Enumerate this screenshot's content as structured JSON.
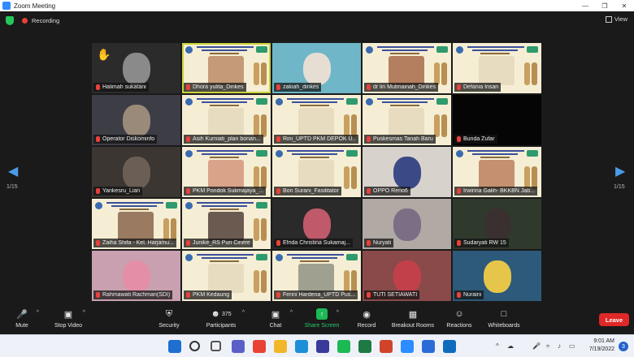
{
  "window": {
    "title": "Zoom Meeting"
  },
  "meeting": {
    "recording_label": "Recording",
    "view_label": "View"
  },
  "gallery": {
    "page_left": "1/15",
    "page_right": "1/15",
    "tiles": [
      {
        "name": "Halimah sukatani",
        "kind": "video",
        "bg": "#2b2b2b",
        "face": "#8a8a8a",
        "hand": true
      },
      {
        "name": "Dhora yulita_Dinkes",
        "kind": "poster",
        "inset": "#c49a78",
        "active": true
      },
      {
        "name": "zakiah_dinkes",
        "kind": "video",
        "bg": "#6fb6c8",
        "face": "#e7ded3"
      },
      {
        "name": "dr lin Mutmainah_Dinkes",
        "kind": "poster",
        "inset": "#b47f5e"
      },
      {
        "name": "Defania Insan",
        "kind": "poster",
        "inset": "#e8dcc0"
      },
      {
        "name": "Operator Diskominfo",
        "kind": "video",
        "bg": "#3d3d46",
        "face": "#9a8a7a"
      },
      {
        "name": "Asih Kurniati_plan bonan...",
        "kind": "poster",
        "inset": "#e8dcc0"
      },
      {
        "name": "Rini_UPTD PKM DEPOK U...",
        "kind": "poster",
        "inset": "#e8dcc0"
      },
      {
        "name": "Puskesmas Tanah Baru",
        "kind": "poster",
        "inset": "#e8dcc0"
      },
      {
        "name": "Bunda Zufar",
        "kind": "video",
        "bg": "#050505",
        "face": "#050505"
      },
      {
        "name": "Yankesru_Lian",
        "kind": "video",
        "bg": "#3b3632",
        "face": "#6b5f55"
      },
      {
        "name": "PKM Pondok Sukmajaya_...",
        "kind": "poster",
        "inset": "#d9a38a"
      },
      {
        "name": "Bon Surani_Fasilitator",
        "kind": "poster",
        "inset": "#e8dcc0"
      },
      {
        "name": "OPPO Reno6",
        "kind": "video",
        "bg": "#d8d2cc",
        "face": "#3b4a86"
      },
      {
        "name": "Irwinna Galih- BKKBN Jab...",
        "kind": "poster",
        "inset": "#c49070"
      },
      {
        "name": "Zaiha Shifa - Kel. Harjamu...",
        "kind": "poster",
        "inset": "#9a7a60"
      },
      {
        "name": "Junike_RS Puri Cinere",
        "kind": "poster",
        "inset": "#6a5a50"
      },
      {
        "name": "Efrida Christina Sukamaj...",
        "kind": "video",
        "bg": "#2a2a2a",
        "face": "#c05a6a"
      },
      {
        "name": "Nuryati",
        "kind": "video",
        "bg": "#b0a9a4",
        "face": "#7a6f84"
      },
      {
        "name": "Sudaryati RW 15",
        "kind": "video",
        "bg": "#2f3a2c",
        "face": "#3a3030"
      },
      {
        "name": "Rahmawati Rachman(SDI)",
        "kind": "video",
        "bg": "#c9a0b0",
        "face": "#e38fa8"
      },
      {
        "name": "PKM Kedaung",
        "kind": "poster",
        "inset": "#e8dcc0"
      },
      {
        "name": "Fenni Hardena_UPTD Pus...",
        "kind": "poster",
        "inset": "#a0a090"
      },
      {
        "name": "TUTI SETIAWATI",
        "kind": "video",
        "bg": "#8a4a4a",
        "face": "#c2404a"
      },
      {
        "name": "Nuraini",
        "kind": "video",
        "bg": "#2d5a7a",
        "face": "#e6c64a"
      }
    ]
  },
  "toolbar": {
    "mute": "Mute",
    "stop_video": "Stop Video",
    "security": "Security",
    "participants": "Participants",
    "participant_count": "375",
    "chat": "Chat",
    "share_screen": "Share Screen",
    "record": "Record",
    "breakout": "Breakout Rooms",
    "reactions": "Reactions",
    "whiteboards": "Whiteboards",
    "leave": "Leave"
  },
  "taskbar": {
    "time": "9:01 AM",
    "date": "7/19/2022",
    "notifications": "3",
    "icons": [
      "windows-icon",
      "search-icon",
      "task-view-icon",
      "teams-icon",
      "chrome-icon",
      "file-explorer-icon",
      "edge-icon",
      "app-icon",
      "spotify-icon",
      "excel-icon",
      "powerpoint-icon",
      "zoom-icon",
      "store-icon",
      "outlook-icon"
    ]
  },
  "colors": {
    "accent": "#2d8cff",
    "leave": "#e02828",
    "share": "#1db954",
    "active_speaker": "#c8d33b"
  }
}
